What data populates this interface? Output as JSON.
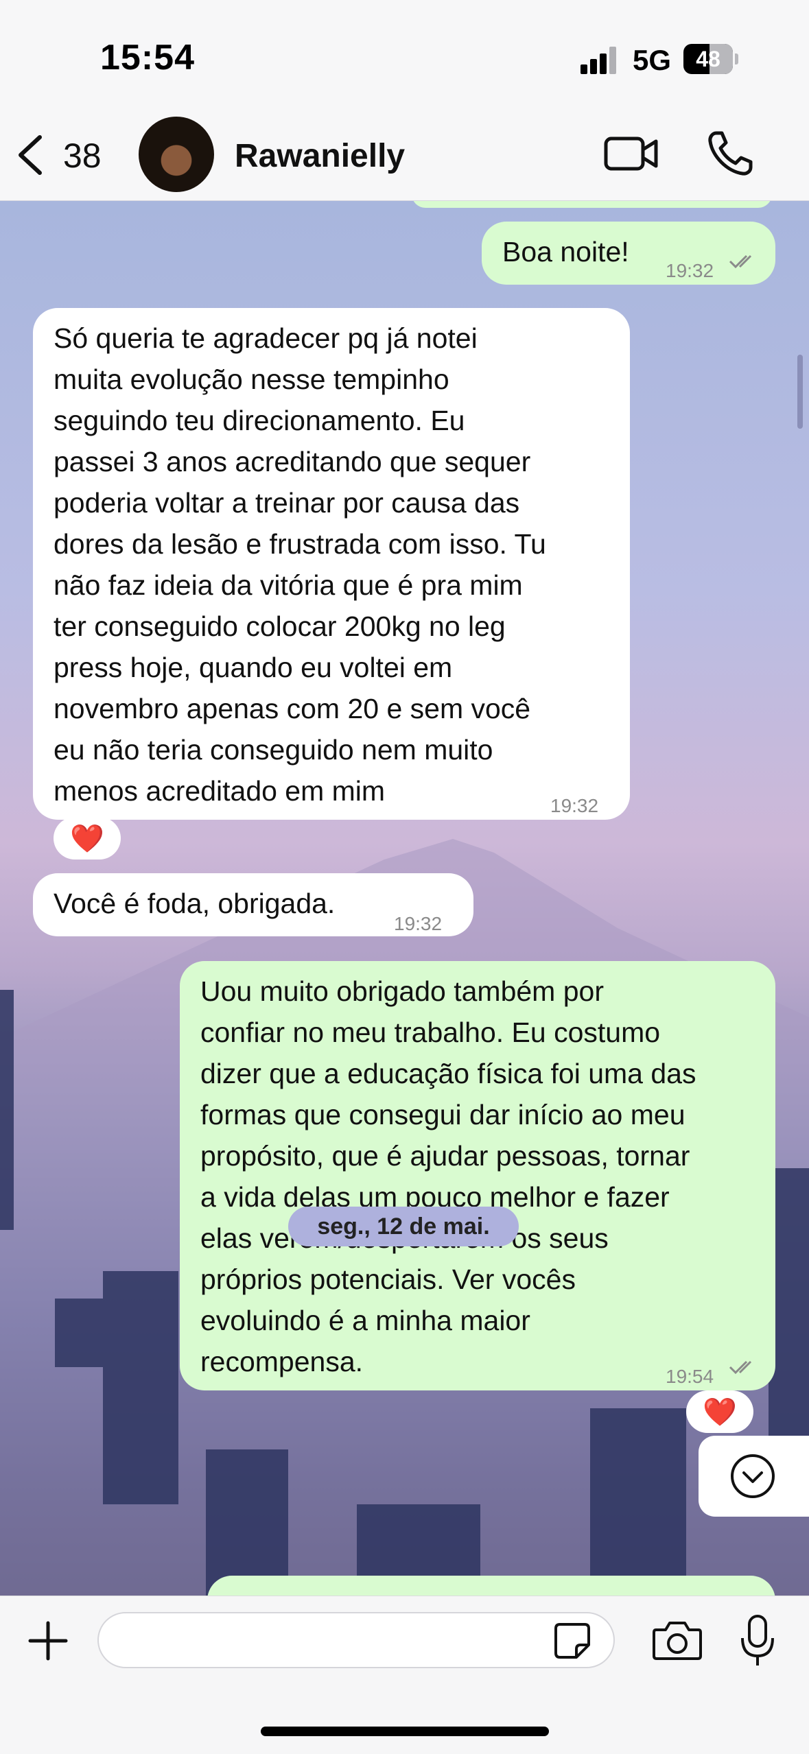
{
  "status_bar": {
    "time": "15:54",
    "network": "5G",
    "battery": "48"
  },
  "header": {
    "back_count": "38",
    "contact_name": "Rawanielly"
  },
  "messages": [
    {
      "text": "Boa noite!",
      "time": "19:32"
    },
    {
      "text": "Só queria te agradecer pq já notei\nmuita evolução nesse tempinho\nseguindo teu direcionamento. Eu\npassei 3 anos acreditando que sequer\npoderia voltar a treinar por causa das\ndores da lesão e frustrada com isso. Tu\nnão faz ideia da vitória que é pra mim\nter conseguido colocar 200kg no leg\npress hoje, quando eu voltei em\nnovembro apenas com 20 e sem você\neu não teria conseguido nem muito\nmenos acreditado em mim",
      "time": "19:32",
      "reaction": "❤️"
    },
    {
      "text": "Você é foda, obrigada.",
      "time": "19:32"
    },
    {
      "text": "Uou muito obrigado também por\nconfiar no meu trabalho. Eu costumo\ndizer que a educação física foi uma das\nformas que consegui dar início ao meu\npropósito, que é ajudar pessoas, tornar\na vida delas um pouco melhor e fazer\nelas verem/despertarem os seus\npróprios potenciais. Ver vocês\nevoluindo é a minha maior\nrecompensa.",
      "time": "19:54",
      "reaction": "❤️"
    }
  ],
  "date_separator": "seg., 12 de mai.",
  "colors": {
    "outgoing_bubble": "#d9fbd0",
    "incoming_bubble": "#ffffff",
    "date_chip": "#aeb1dd"
  },
  "icons": [
    "back-chevron-icon",
    "video-call-icon",
    "phone-call-icon",
    "scroll-down-icon",
    "plus-icon",
    "sticker-icon",
    "camera-icon",
    "microphone-icon"
  ]
}
